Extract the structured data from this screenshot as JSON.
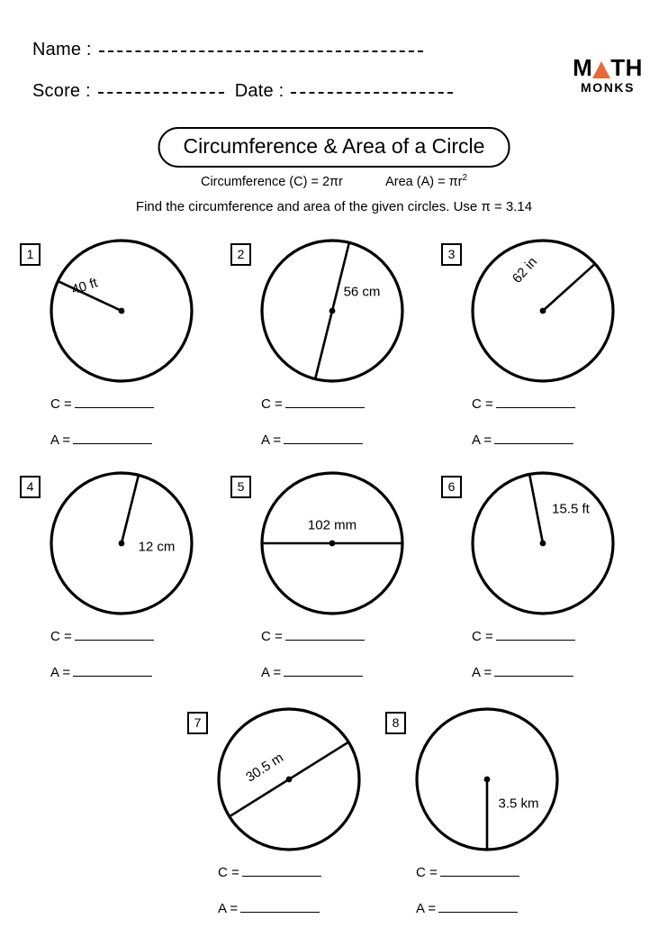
{
  "header": {
    "name_label": "Name :",
    "score_label": "Score :",
    "date_label": "Date :"
  },
  "logo": {
    "primary": "M",
    "primary_tail": "TH",
    "secondary": "MONKS",
    "accent_color": "#e8683a"
  },
  "title": "Circumference & Area of a Circle",
  "formulas": {
    "circumference": "Circumference (C) = 2πr",
    "area_prefix": "Area (A) = πr",
    "area_exponent": "2"
  },
  "instruction": "Find the circumference and area of the given circles.  Use  π = 3.14",
  "answers": {
    "circumference_label": "C =",
    "area_label": "A ="
  },
  "problems": [
    {
      "number": "1",
      "measure": "40 ft",
      "kind": "radius",
      "rotation": -18
    },
    {
      "number": "2",
      "measure": "56 cm",
      "kind": "diameter",
      "rotation": 0
    },
    {
      "number": "3",
      "measure": "62 in",
      "kind": "radius",
      "rotation": -48
    },
    {
      "number": "4",
      "measure": "12 cm",
      "kind": "radius",
      "rotation": 0
    },
    {
      "number": "5",
      "measure": "102 mm",
      "kind": "diameter",
      "rotation": 0
    },
    {
      "number": "6",
      "measure": "15.5 ft",
      "kind": "radius",
      "rotation": 0
    },
    {
      "number": "7",
      "measure": "30.5 m",
      "kind": "diameter",
      "rotation": -33
    },
    {
      "number": "8",
      "measure": "3.5 km",
      "kind": "radius",
      "rotation": 0
    }
  ]
}
